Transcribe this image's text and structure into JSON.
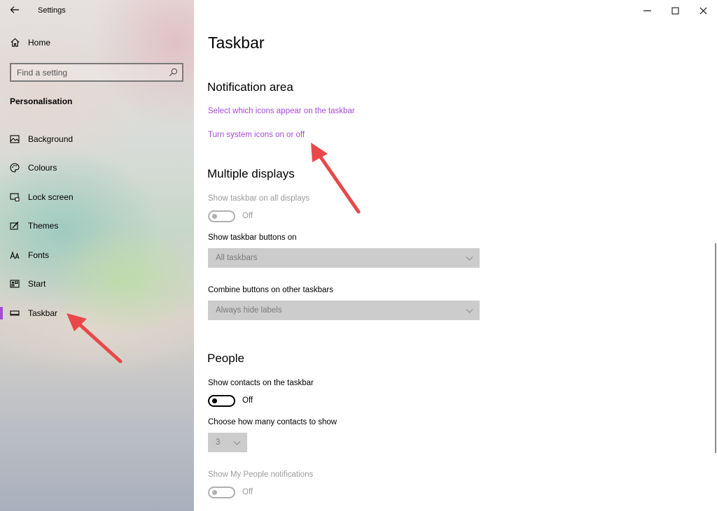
{
  "app": {
    "title": "Settings"
  },
  "sidebar": {
    "home_label": "Home",
    "search_placeholder": "Find a setting",
    "section": "Personalisation",
    "items": [
      {
        "label": "Background",
        "icon": "picture-icon"
      },
      {
        "label": "Colours",
        "icon": "palette-icon"
      },
      {
        "label": "Lock screen",
        "icon": "lock-screen-icon"
      },
      {
        "label": "Themes",
        "icon": "themes-icon"
      },
      {
        "label": "Fonts",
        "icon": "fonts-icon"
      },
      {
        "label": "Start",
        "icon": "start-icon"
      },
      {
        "label": "Taskbar",
        "icon": "taskbar-icon",
        "active": true
      }
    ]
  },
  "main": {
    "title": "Taskbar",
    "notification_area": {
      "heading": "Notification area",
      "link_icons": "Select which icons appear on the taskbar",
      "link_system": "Turn system icons on or off"
    },
    "multiple_displays": {
      "heading": "Multiple displays",
      "show_all_label": "Show taskbar on all displays",
      "show_all_state": "Off",
      "buttons_on_label": "Show taskbar buttons on",
      "buttons_on_value": "All taskbars",
      "combine_label": "Combine buttons on other taskbars",
      "combine_value": "Always hide labels"
    },
    "people": {
      "heading": "People",
      "contacts_label": "Show contacts on the taskbar",
      "contacts_state": "Off",
      "count_label": "Choose how many contacts to show",
      "count_value": "3",
      "notif_label": "Show My People notifications",
      "notif_state": "Off"
    }
  },
  "colors": {
    "accent": "#a64bd6",
    "arrow": "#e8484a"
  }
}
